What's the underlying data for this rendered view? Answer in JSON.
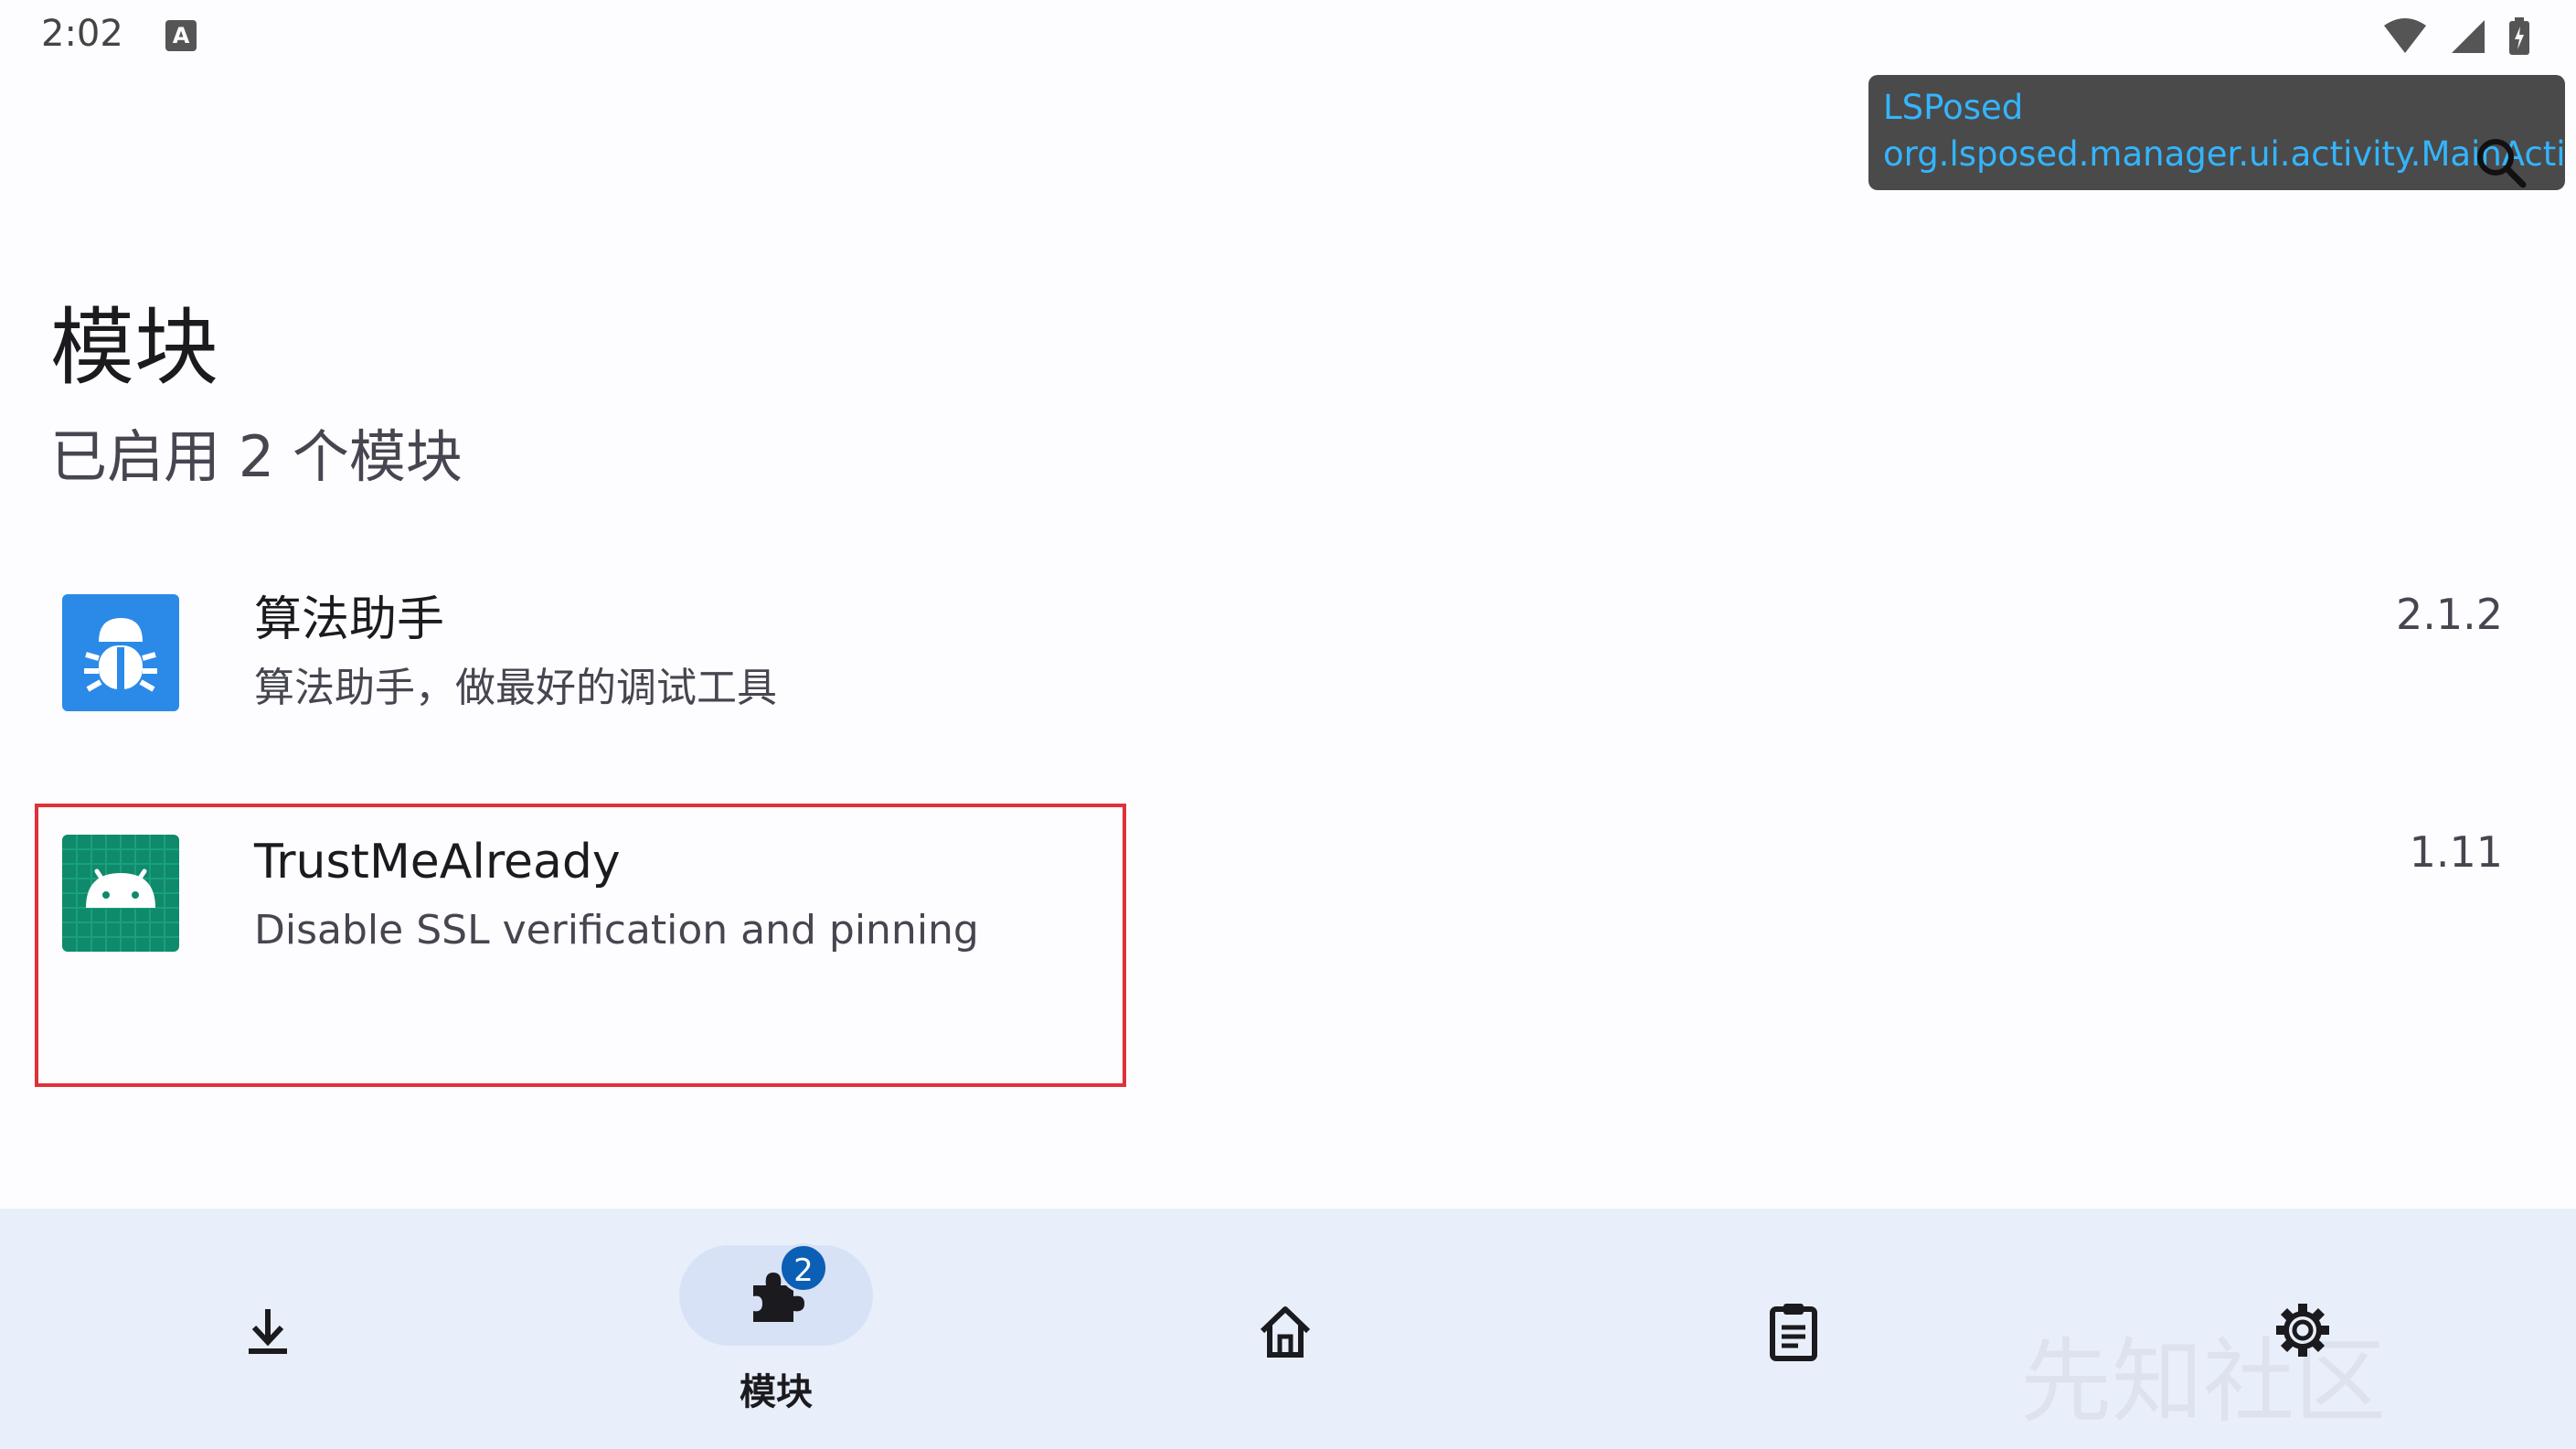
{
  "status_bar": {
    "time": "2:02",
    "notification_icon": "A"
  },
  "overlay": {
    "line1": "LSPosed",
    "line2": "org.lsposed.manager.ui.activity.MainActivity"
  },
  "page": {
    "title": "模块",
    "subtitle": "已启用 2 个模块"
  },
  "modules": [
    {
      "name": "算法助手",
      "description": "算法助手，做最好的调试工具",
      "version": "2.1.2",
      "icon": "bug-icon",
      "icon_color": "#2b8ae8"
    },
    {
      "name": "TrustMeAlready",
      "description": "Disable SSL verification and pinning",
      "version": "1.11",
      "icon": "android-icon",
      "icon_color": "#0f8a6a"
    }
  ],
  "bottom_nav": {
    "items": [
      {
        "icon": "download-icon",
        "label": ""
      },
      {
        "icon": "puzzle-icon",
        "label": "模块",
        "badge": "2"
      },
      {
        "icon": "home-icon",
        "label": ""
      },
      {
        "icon": "clipboard-icon",
        "label": ""
      },
      {
        "icon": "gear-icon",
        "label": ""
      }
    ]
  },
  "watermark": "先知社区",
  "colors": {
    "accent": "#0b5fb4",
    "highlight_border": "#e0313a",
    "nav_background": "#e9effa"
  }
}
